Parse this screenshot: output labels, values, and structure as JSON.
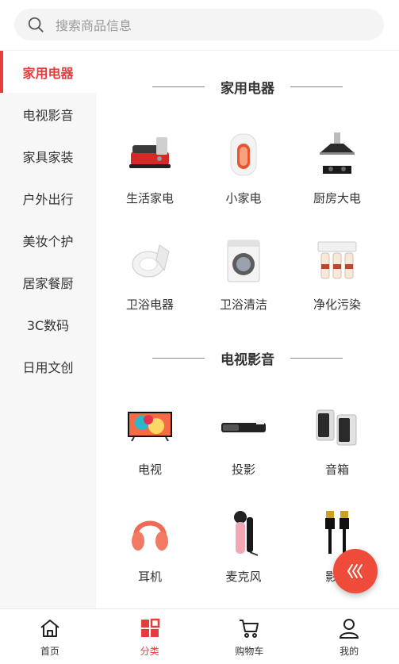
{
  "search": {
    "placeholder": "搜索商品信息"
  },
  "sidebar": {
    "items": [
      {
        "label": "家用电器",
        "active": true
      },
      {
        "label": "电视影音"
      },
      {
        "label": "家具家装"
      },
      {
        "label": "户外出行"
      },
      {
        "label": "美妆个护"
      },
      {
        "label": "居家餐厨"
      },
      {
        "label": "3C数码"
      },
      {
        "label": "日用文创"
      }
    ]
  },
  "sections": [
    {
      "title": "家用电器",
      "items": [
        {
          "label": "生活家电",
          "icon": "electric-grill-icon"
        },
        {
          "label": "小家电",
          "icon": "space-heater-icon"
        },
        {
          "label": "厨房大电",
          "icon": "range-hood-stove-icon"
        },
        {
          "label": "卫浴电器",
          "icon": "smart-toilet-seat-icon"
        },
        {
          "label": "卫浴清洁",
          "icon": "washing-machine-icon"
        },
        {
          "label": "净化污染",
          "icon": "water-purifier-icon"
        }
      ]
    },
    {
      "title": "电视影音",
      "items": [
        {
          "label": "电视",
          "icon": "television-icon"
        },
        {
          "label": "投影",
          "icon": "projector-icon"
        },
        {
          "label": "音箱",
          "icon": "speakers-icon"
        },
        {
          "label": "耳机",
          "icon": "headphones-icon"
        },
        {
          "label": "麦克风",
          "icon": "microphone-icon"
        },
        {
          "label": "影音",
          "icon": "hdmi-cable-icon"
        }
      ]
    }
  ],
  "fab": {
    "icon": "chevron-arrows-icon"
  },
  "tabbar": {
    "items": [
      {
        "label": "首页",
        "icon": "home-icon"
      },
      {
        "label": "分类",
        "icon": "category-icon",
        "active": true
      },
      {
        "label": "购物车",
        "icon": "cart-icon"
      },
      {
        "label": "我的",
        "icon": "user-icon"
      }
    ]
  },
  "colors": {
    "accent": "#e63c3c",
    "fab": "#ef4b3b",
    "sidebar_bg": "#f7f7f7",
    "search_bg": "#f4f4f4"
  }
}
